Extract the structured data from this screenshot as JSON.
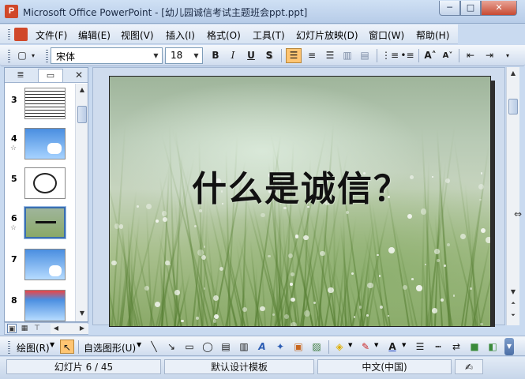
{
  "window": {
    "title": "Microsoft Office PowerPoint - [幼儿园诚信考试主题班会ppt.ppt]",
    "app_icon_glyph": "P",
    "minimize_glyph": "─",
    "maximize_glyph": "□",
    "close_glyph": "✕"
  },
  "menu": {
    "items": [
      {
        "label": "文件(F)"
      },
      {
        "label": "编辑(E)"
      },
      {
        "label": "视图(V)"
      },
      {
        "label": "插入(I)"
      },
      {
        "label": "格式(O)"
      },
      {
        "label": "工具(T)"
      },
      {
        "label": "幻灯片放映(D)"
      },
      {
        "label": "窗口(W)"
      },
      {
        "label": "帮助(H)"
      }
    ]
  },
  "formatting": {
    "font_name": "宋体",
    "font_size": "18",
    "bold": "B",
    "italic": "I",
    "underline": "U",
    "shadow": "S",
    "increase_font": "A˄",
    "decrease_font": "A˅",
    "alignment_selected": "left"
  },
  "outline_tabs": {
    "outline_icon": "outline-tab-icon",
    "slides_icon": "slides-tab-icon",
    "close_glyph": "✕"
  },
  "thumbnails": [
    {
      "number": "3",
      "star": ""
    },
    {
      "number": "4",
      "star": "☆"
    },
    {
      "number": "5",
      "star": ""
    },
    {
      "number": "6",
      "star": "☆",
      "selected": true
    },
    {
      "number": "7",
      "star": ""
    },
    {
      "number": "8",
      "star": ""
    }
  ],
  "slide": {
    "title": "什么是诚信？"
  },
  "drawing": {
    "draw_label": "绘图(R)",
    "autoshapes_label": "自选图形(U)",
    "end_glyph": "▼"
  },
  "status": {
    "slide_counter": "幻灯片 6 / 45",
    "design_template": "默认设计模板",
    "language": "中文(中国)"
  },
  "colors": {
    "accent_active": "#ffc572",
    "toolbar_bg": "#cfdcee",
    "close_red": "#c74a33"
  }
}
